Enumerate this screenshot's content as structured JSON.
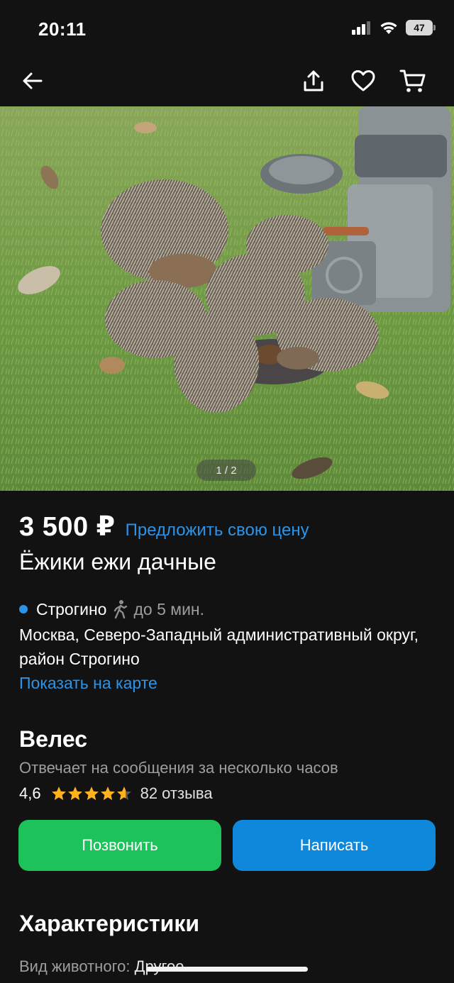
{
  "status_bar": {
    "time": "20:11",
    "battery": "47"
  },
  "listing": {
    "image_counter": "1 / 2",
    "price": "3 500 ₽",
    "offer_price_link": "Предложить свою цену",
    "title": "Ёжики ежи дачные",
    "metro_station": "Строгино",
    "metro_walk_time": "до 5 мин.",
    "address": "Москва, Северо-Западный административный округ, район Строгино",
    "show_on_map_link": "Показать на карте"
  },
  "seller": {
    "name": "Велес",
    "response_time": "Отвечает на сообщения за несколько часов",
    "rating": "4,6",
    "rating_value": 4.6,
    "reviews": "82 отзыва"
  },
  "actions": {
    "call_label": "Позвонить",
    "write_label": "Написать"
  },
  "characteristics": {
    "title": "Характеристики",
    "rows": [
      {
        "label": "Вид животного:",
        "value": "Другое"
      }
    ]
  },
  "colors": {
    "background": "#121212",
    "accent_blue": "#2b94e8",
    "call_green": "#1ec25a",
    "write_blue": "#0f88dc",
    "star": "#ffb21e"
  },
  "icons": {
    "back": "arrow-left-icon",
    "share": "share-icon",
    "favorite": "heart-icon",
    "cart": "cart-icon",
    "walk": "walking-person-icon"
  }
}
